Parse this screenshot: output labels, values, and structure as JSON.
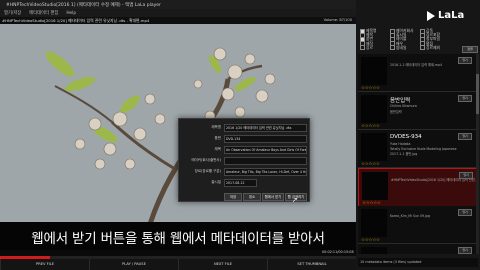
{
  "window": {
    "title": "#HNPTechVideoStudio[2016 1] (메타데이터 수정 예제) - 맥앱 LaLa player",
    "min": "—",
    "max": "☐",
    "close": "✕"
  },
  "menu": [
    "열기/저장",
    "메타데이터 편집",
    "Help"
  ],
  "path": "#HNPTechVideoStudio[2016 1/20] 메타데이터 입력 관련 유닛지닝 .dts - 확대편.mp4",
  "volume": "Volume: 87/100",
  "subtitle": "웹에서 받기 버튼을 통해 웹에서 메타데이터를 받아서",
  "playback": {
    "progress": 0.14,
    "time": "00:02:11/00:15:08"
  },
  "controls": [
    "PREV FILE",
    "PLAY / PAUSE",
    "NEXT FILE",
    "SET THUMBNAIL"
  ],
  "dialog": {
    "fields": [
      {
        "label": "제목명",
        "value": "2016 1/20 메타데이터 입력 관련 유닛지닝 .dts"
      },
      {
        "label": "품번",
        "value": "DVD-134"
      },
      {
        "label": "제목",
        "value": "An Observation Of Amateur Boys And Girls Of Forest Group NF-2"
      },
      {
        "label": "메이커(회사/출판사)",
        "value": ""
      },
      {
        "label": "장르(장르를 구분)",
        "value": "Amateur, Big Tits, Big Tits Lover, Hi-Def, Over 4 Hours, Nampa, Big Tits"
      },
      {
        "label": "출시일",
        "value": "2017-08-12"
      }
    ],
    "buttons": [
      "저장",
      "취소",
      "웹에서 받기",
      "웹 검색하기"
    ]
  },
  "panel": {
    "logo": "LaLa",
    "checks": [
      {
        "label": "제목명",
        "checked": true
      },
      {
        "label": "제목",
        "checked": false
      },
      {
        "label": "품번",
        "checked": true
      },
      {
        "label": "제작",
        "checked": false
      },
      {
        "label": "장르",
        "checked": false
      },
      {
        "label": "메이커회사",
        "checked": false
      },
      {
        "label": "출시일",
        "checked": false
      },
      {
        "label": "레이블",
        "checked": false
      },
      {
        "label": "배우",
        "checked": false
      },
      {
        "label": "썸네일",
        "checked": false
      },
      {
        "label": "감독",
        "checked": false
      },
      {
        "label": "장르포함",
        "checked": false
      },
      {
        "label": "청부파일",
        "checked": false
      },
      {
        "label": "평점",
        "checked": false
      },
      {
        "label": "장르제외",
        "checked": false
      }
    ],
    "go": "정렬"
  },
  "items": [
    {
      "title": "",
      "lines": [
        "2016-1-1 메타데이터 입력 예제.mp4"
      ],
      "stars": "☆☆☆☆☆",
      "btn": "열기"
    },
    {
      "title": "음반입력",
      "lines": [
        "Chihiro Kitamura",
        "음반입력"
      ],
      "stars": "☆☆☆☆☆",
      "btn": "열기"
    },
    {
      "title": "DVDES-934",
      "lines": [
        "Yuka Hodaka",
        "Totally Exclusive Nude Modeling Japanese",
        "2017-1-1 음반.jpg"
      ],
      "stars": "☆☆☆☆☆",
      "btn": "열기"
    },
    {
      "title": "",
      "lines": [
        "#HNPTechVideoStudio[2016 1/20] 메타데이터 입력 관련..."
      ],
      "stars": "☆☆☆☆☆",
      "btn": "열기",
      "selected": true
    },
    {
      "title": "",
      "lines": [
        "Korea_Kim_Mi Sun 09.jpg"
      ],
      "stars": "☆☆☆☆☆",
      "btn": "열기"
    },
    {
      "title": "",
      "lines": [
        ""
      ],
      "stars": "☆☆☆☆☆",
      "btn": "열기"
    }
  ],
  "status": "10 metadata items (3 files) updated"
}
